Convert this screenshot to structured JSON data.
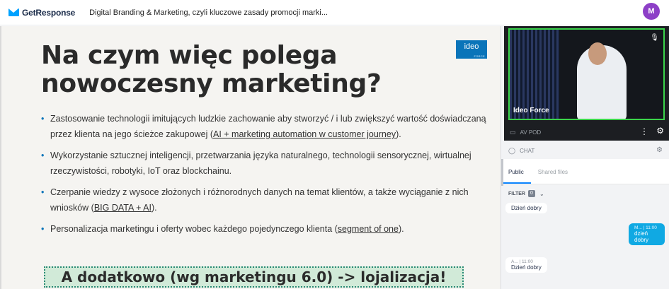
{
  "header": {
    "logo_text": "GetResponse",
    "title": "Digital Branding & Marketing, czyli kluczowe zasady promocji marki...",
    "avatar_initial": "M"
  },
  "slide": {
    "title": "Na czym więc polega nowoczesny marketing?",
    "brand": {
      "text": "ideo",
      "sub": "FORCE"
    },
    "bullets": [
      {
        "text": "Zastosowanie technologii imitujących ludzkie zachowanie  aby stworzyć / i lub zwiększyć wartość doświadczaną przez klienta na jego ścieżce zakupowej (",
        "link": "AI + marketing automation w customer journey",
        "tail": ")."
      },
      {
        "text": "Wykorzystanie sztucznej inteligencji, przetwarzania języka naturalnego, technologii sensorycznej, wirtualnej rzeczywistości, robotyki, IoT oraz blockchainu.",
        "link": "",
        "tail": ""
      },
      {
        "text": "Czerpanie wiedzy z wysoce złożonych i różnorodnych danych na temat klientów, a także wyciąganie z nich wniosków (",
        "link": "BIG DATA + AI",
        "tail": ")."
      },
      {
        "text": "Personalizacja marketingu i oferty wobec każdego pojedynczego klienta (",
        "link": "segment of one",
        "tail": ")."
      }
    ],
    "banner": "A dodatkowo (wg marketingu 6.0) -> lojalizacja!"
  },
  "video": {
    "name": "Ideo Force",
    "bar_label": "AV POD"
  },
  "chat": {
    "label": "CHAT",
    "tabs": [
      "Public",
      "Shared files"
    ],
    "filter_label": "FILTER",
    "filter_count": "0",
    "messages": [
      {
        "meta": "",
        "text": "Dzień dobry",
        "dir": "in"
      },
      {
        "meta": "M... | 11:00",
        "text": "dzień dobry",
        "dir": "out"
      },
      {
        "meta": "A... | 11:00",
        "text": "Dzień dobry",
        "dir": "in"
      }
    ]
  },
  "colors": {
    "accent": "#0c85ff",
    "avatar": "#8d3fc7",
    "speaker_border": "#3bd44a",
    "banner_bg": "#d1ead8",
    "outgoing_bubble": "#10a9e3"
  },
  "icons": [
    "getresponse-logo-icon",
    "mic-icon",
    "camera-icon",
    "kebab-menu-icon",
    "gear-icon",
    "chat-icon",
    "chevron-down-icon"
  ]
}
